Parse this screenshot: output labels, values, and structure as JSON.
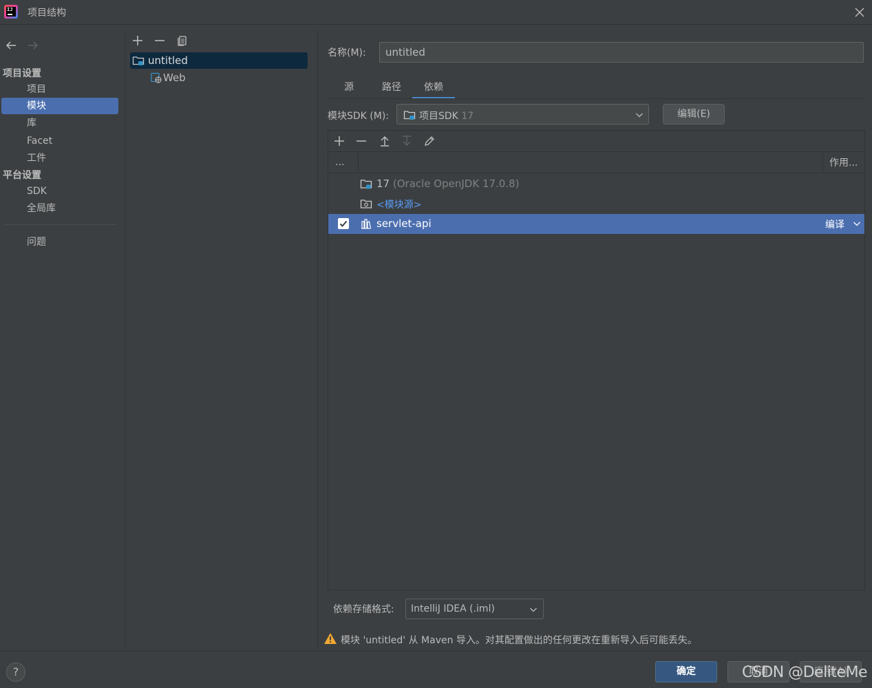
{
  "window": {
    "title": "项目结构"
  },
  "nav": {
    "back": "back-arrow-icon",
    "forward": "forward-arrow-icon"
  },
  "sidebar": {
    "project_settings_header": "项目设置",
    "project_items": [
      {
        "label": "项目"
      },
      {
        "label": "模块"
      },
      {
        "label": "库"
      },
      {
        "label": "Facet"
      },
      {
        "label": "工件"
      }
    ],
    "platform_settings_header": "平台设置",
    "platform_items": [
      {
        "label": "SDK"
      },
      {
        "label": "全局库"
      }
    ],
    "problems_label": "问题"
  },
  "tree": {
    "nodes": [
      {
        "label": "untitled"
      },
      {
        "label": "Web"
      }
    ]
  },
  "module": {
    "name_label": "名称(M):",
    "name_value": "untitled",
    "tabs": [
      {
        "label": "源"
      },
      {
        "label": "路径"
      },
      {
        "label": "依赖"
      }
    ],
    "sdk_label": "模块SDK (M):",
    "sdk_value": "项目SDK",
    "sdk_version": "17",
    "edit_label": "编辑(E)"
  },
  "dependencies": {
    "header_col1": "...",
    "header_scope": "作用...",
    "rows": [
      {
        "label": "17",
        "detail": "(Oracle OpenJDK 17.0.8)"
      },
      {
        "label": "<模块源>"
      },
      {
        "label": "servlet-api",
        "scope": "编译",
        "checked": true
      }
    ]
  },
  "format": {
    "label": "依赖存储格式:",
    "value": "IntelliJ IDEA (.iml)"
  },
  "warning": {
    "text": "模块 'untitled' 从 Maven 导入。对其配置做出的任何更改在重新导入后可能丢失。"
  },
  "buttons": {
    "help": "?",
    "ok": "确定",
    "cancel": "取消",
    "apply": "应用(A)"
  },
  "watermark": "CSDN @DeliteMe",
  "colors": {
    "background": "#3c3f41",
    "selection": "#4b6eaf",
    "tree_selection": "#0d293e",
    "link": "#589df6",
    "tab_underline": "#4a88c7",
    "primary_button": "#365880"
  }
}
